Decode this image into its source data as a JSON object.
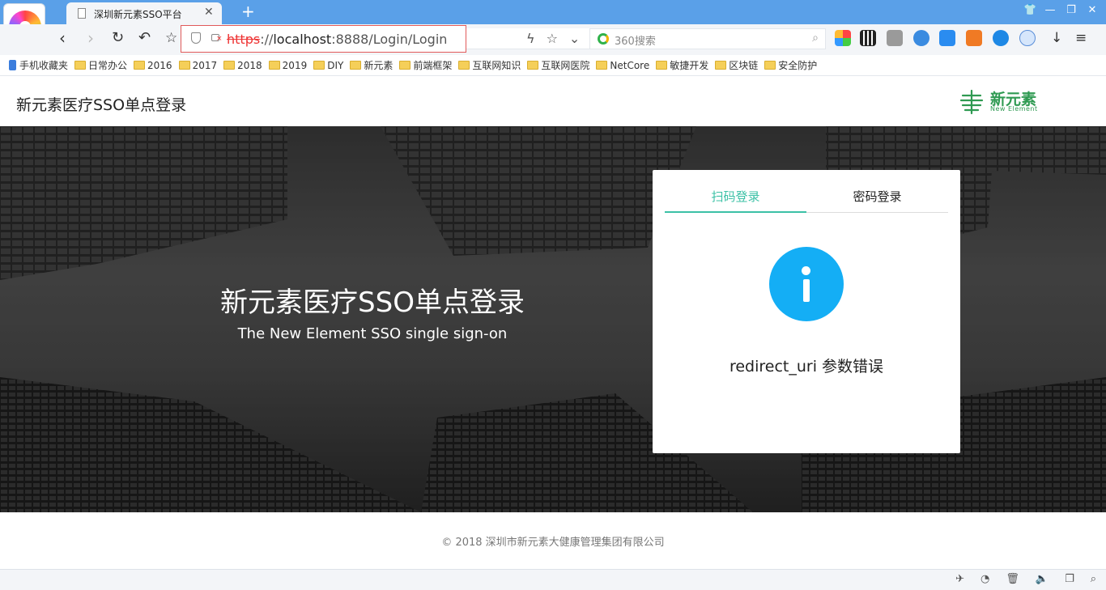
{
  "browser": {
    "tab_title": "深圳新元素SSO平台",
    "tab_close": "✕",
    "new_tab": "+",
    "url_protocol": "https",
    "url_sep": "://",
    "url_host": "localhost",
    "url_rest": ":8888/Login/Login",
    "search_placeholder": "360搜索",
    "window_buttons": [
      "👕",
      "—",
      "❐",
      "✕"
    ]
  },
  "bookmarks": [
    {
      "label": "手机收藏夹",
      "icon": "phone"
    },
    {
      "label": "日常办公",
      "icon": "folder"
    },
    {
      "label": "2016",
      "icon": "folder"
    },
    {
      "label": "2017",
      "icon": "folder"
    },
    {
      "label": "2018",
      "icon": "folder"
    },
    {
      "label": "2019",
      "icon": "folder"
    },
    {
      "label": "DIY",
      "icon": "folder"
    },
    {
      "label": "新元素",
      "icon": "folder"
    },
    {
      "label": "前端框架",
      "icon": "folder"
    },
    {
      "label": "互联网知识",
      "icon": "folder"
    },
    {
      "label": "互联网医院",
      "icon": "folder"
    },
    {
      "label": "NetCore",
      "icon": "folder"
    },
    {
      "label": "敏捷开发",
      "icon": "folder"
    },
    {
      "label": "区块链",
      "icon": "folder"
    },
    {
      "label": "安全防护",
      "icon": "folder"
    }
  ],
  "header": {
    "site_title": "新元素医疗SSO单点登录",
    "brand_cn": "新元素",
    "brand_en": "New Element",
    "brand_color": "#2f9a52"
  },
  "hero": {
    "title": "新元素医疗SSO单点登录",
    "subtitle": "The New Element SSO single sign-on"
  },
  "login": {
    "tab_scan": "扫码登录",
    "tab_password": "密码登录",
    "active_tab": "扫码登录",
    "message": "redirect_uri 参数错误",
    "accent": "#3cc1a6",
    "info_color": "#14aef5"
  },
  "footer": {
    "text": "© 2018   深圳市新元素大健康管理集团有限公司"
  }
}
